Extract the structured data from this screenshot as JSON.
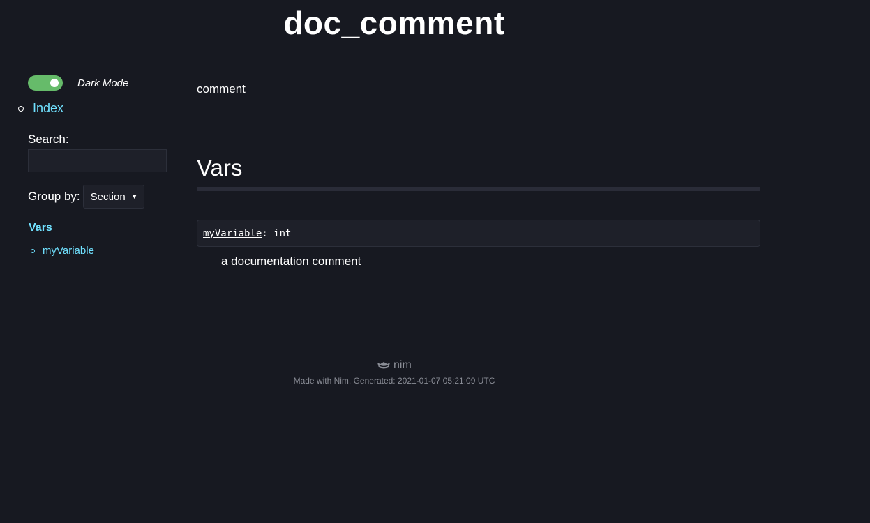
{
  "page": {
    "title": "doc_comment"
  },
  "sidebar": {
    "theme_label": "Dark Mode",
    "theme_enabled": true,
    "index_link": "Index",
    "search_label": "Search:",
    "search_value": "",
    "group_by_label": "Group by:",
    "group_by_value": "Section",
    "toc": {
      "section": "Vars",
      "items": [
        {
          "label": "myVariable"
        }
      ]
    }
  },
  "content": {
    "module_description": "comment",
    "section_title": "Vars",
    "declaration": {
      "name": "myVariable",
      "rest": ": int",
      "description": "a documentation comment"
    }
  },
  "footer": {
    "logo_text": "nim",
    "generated": "Made with Nim. Generated: 2021-01-07 05:21:09 UTC"
  },
  "colors": {
    "background": "#171921",
    "link": "#70e1ff",
    "toggle_on": "#66bb6a",
    "muted": "#8a8d96"
  }
}
